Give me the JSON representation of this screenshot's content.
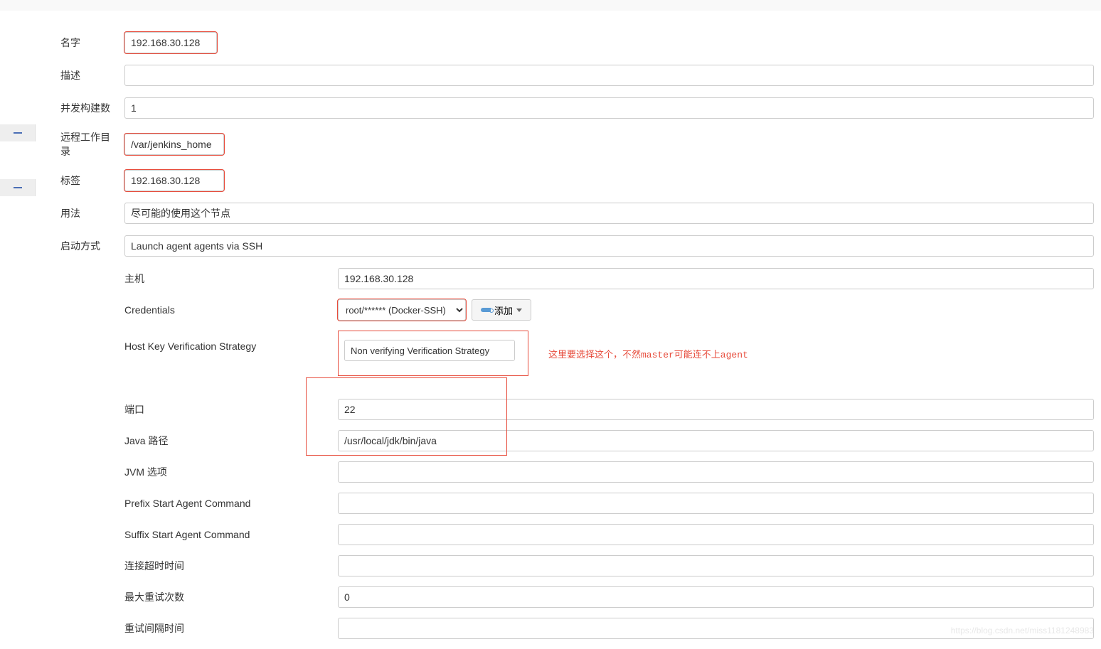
{
  "form": {
    "name": {
      "label": "名字",
      "value": "192.168.30.128"
    },
    "description": {
      "label": "描述",
      "value": ""
    },
    "executors": {
      "label": "并发构建数",
      "value": "1"
    },
    "remote_root": {
      "label": "远程工作目录",
      "value": "/var/jenkins_home"
    },
    "labels": {
      "label": "标签",
      "value": "192.168.30.128"
    },
    "usage": {
      "label": "用法",
      "value": "尽可能的使用这个节点"
    },
    "launch": {
      "label": "启动方式",
      "value": "Launch agent agents via SSH"
    }
  },
  "ssh": {
    "host": {
      "label": "主机",
      "value": "192.168.30.128"
    },
    "credentials": {
      "label": "Credentials",
      "selected": "root/****** (Docker-SSH)",
      "add_button": "添加"
    },
    "host_key": {
      "label": "Host Key Verification Strategy",
      "value": "Non verifying Verification Strategy",
      "annotation": "这里要选择这个，不然master可能连不上agent"
    },
    "port": {
      "label": "端口",
      "value": "22"
    },
    "java_path": {
      "label": "Java 路径",
      "value": "/usr/local/jdk/bin/java"
    },
    "jvm_options": {
      "label": "JVM 选项",
      "value": ""
    },
    "prefix_cmd": {
      "label": "Prefix Start Agent Command",
      "value": ""
    },
    "suffix_cmd": {
      "label": "Suffix Start Agent Command",
      "value": ""
    },
    "conn_timeout": {
      "label": "连接超时时间",
      "value": ""
    },
    "max_retries": {
      "label": "最大重试次数",
      "value": "0"
    },
    "retry_wait": {
      "label": "重试间隔时间",
      "value": ""
    }
  },
  "watermark": "https://blog.csdn.net/miss1181248983"
}
